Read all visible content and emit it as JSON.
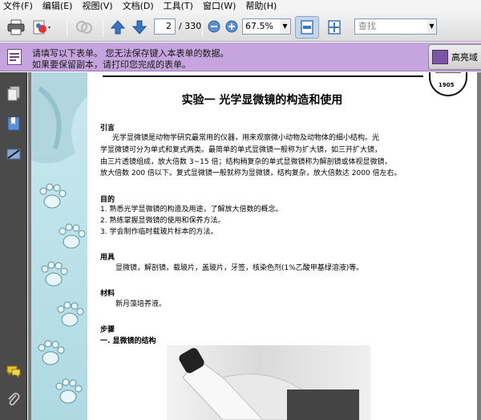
{
  "menu": [
    "文件(F)",
    "编辑(E)",
    "视图(V)",
    "文档(D)",
    "工具(T)",
    "窗口(W)",
    "帮助(H)"
  ],
  "toolbar": {
    "page_current": "2",
    "page_total": "/ 330",
    "zoom": "67.5%",
    "search_placeholder": "查找",
    "dropdown_glyph": "▼"
  },
  "banner": {
    "line1": "请填写以下表单。 您无法保存键入本表单的数据。",
    "line2": "如果要保留副本，请打印您完成的表单。",
    "highlight_label": "高亮域"
  },
  "doc": {
    "title": "实验一    光学显微镜的构造和使用",
    "seal_year": "1905",
    "intro_heading": "引言",
    "intro_lines": [
      "光学显微镜是动物学研究最常用的仪器，用来观察微小动物及动物体的细小结构。光",
      "学显微镜可分为单式和复式两类。最简单的单式显微镜一般称为扩大镜，如三开扩大镜，",
      "由三片透镜组成，放大倍数 3~15 倍；结构稍复杂的单式显微镜称为解剖镜或体视显微镜，",
      "放大倍数 200 倍以下。复式显微镜一般就称为显微镜，结构复杂，放大倍数达 2000 倍左右。"
    ],
    "aim_heading": "目的",
    "aim_lines": [
      "1. 熟悉光学显微镜的构造及用途，了解放大倍数的概念。",
      "2. 熟练掌握显微镜的使用和保养方法。",
      "3. 学会制作临时载玻片标本的方法。"
    ],
    "tools_heading": "用具",
    "tools_text": "显微镜，解剖镜，载玻片，盖玻片，牙签，核染色剂(1%乙酸甲基绿溶液)等。",
    "material_heading": "材料",
    "material_text": "新月藻培养液。",
    "steps_heading": "步骤",
    "steps_sub": "一. 显微镜的结构"
  },
  "colors": {
    "banner": "#c6a5de",
    "navpane": "#4a4a4a",
    "toolbar_blue": "#3a76c4",
    "decor": "#c9e9ef"
  },
  "icons": [
    "print-icon",
    "create-pdf-icon",
    "collaborate-icon",
    "previous-page-icon",
    "next-page-icon",
    "zoom-out-icon",
    "zoom-in-icon",
    "fit-width-icon",
    "fit-page-icon",
    "form-icon",
    "highlight-fields-icon",
    "pages-icon",
    "bookmarks-icon",
    "signatures-icon",
    "comments-icon",
    "attachments-icon",
    "seal-logo"
  ]
}
